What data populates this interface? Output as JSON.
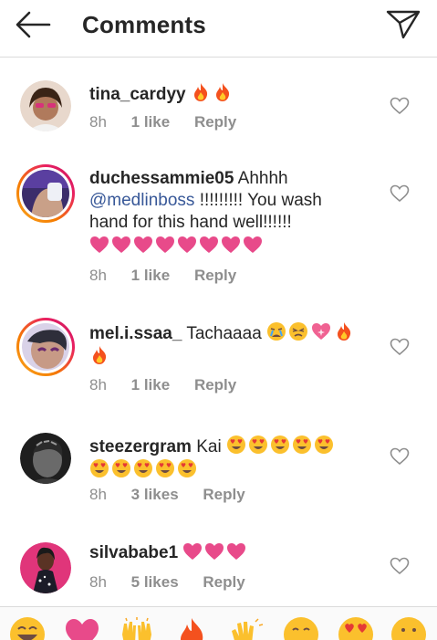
{
  "header": {
    "title": "Comments",
    "back_icon": "arrow-left-icon",
    "share_icon": "send-icon"
  },
  "comments": [
    {
      "username": "tina_cardyy",
      "body": "",
      "emojis": [
        "fire",
        "fire"
      ],
      "time": "8h",
      "likes": "1 like",
      "reply": "Reply"
    },
    {
      "username": "duchessammie05",
      "body": "Ahhhh",
      "mention": "@medlinboss",
      "body2": "!!!!!!!!! You wash hand for this hand well!!!!!!",
      "emojis": [
        "heart",
        "heart",
        "heart",
        "heart",
        "heart",
        "heart",
        "heart",
        "heart"
      ],
      "time": "8h",
      "likes": "1 like",
      "reply": "Reply"
    },
    {
      "username": "mel.i.ssaa_",
      "body": "Tachaaaa",
      "emojis": [
        "crying-face",
        "persevering-face",
        "sparkling-heart",
        "fire",
        "fire"
      ],
      "time": "8h",
      "likes": "1 like",
      "reply": "Reply"
    },
    {
      "username": "steezergram",
      "body": "Kai",
      "emojis": [
        "heart-eyes",
        "heart-eyes",
        "heart-eyes",
        "heart-eyes",
        "heart-eyes",
        "heart-eyes",
        "heart-eyes",
        "heart-eyes",
        "heart-eyes",
        "heart-eyes"
      ],
      "time": "8h",
      "likes": "3 likes",
      "reply": "Reply"
    },
    {
      "username": "silvababe1",
      "body": "",
      "emojis": [
        "heart",
        "heart",
        "heart"
      ],
      "time": "8h",
      "likes": "5 likes",
      "reply": "Reply"
    }
  ],
  "emoji_bar": [
    "grinning-face",
    "heart",
    "raised-hands",
    "fire",
    "clapping-hands",
    "hugging-face",
    "heart-eyes",
    "smiling-face"
  ]
}
